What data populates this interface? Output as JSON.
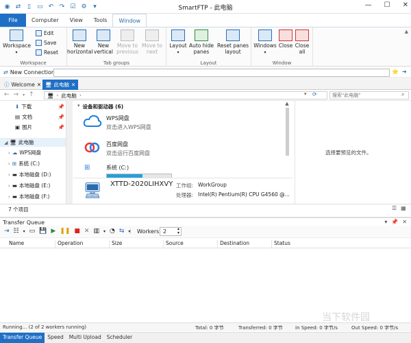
{
  "title": "SmartFTP - 此电脑",
  "window_controls": [
    "—",
    "☐",
    "✕"
  ],
  "ribbon_tabs": [
    "File",
    "Computer",
    "View",
    "Tools",
    "Window"
  ],
  "ribbon": {
    "workspace": {
      "label": "Workspace",
      "big": "Workspace",
      "edit": "Edit",
      "save": "Save",
      "reset": "Reset"
    },
    "tab_groups": {
      "label": "Tab groups",
      "new_horizontal": "New\nhorizontal",
      "new_vertical": "New\nvertical",
      "move_previous": "Move to\nprevious",
      "move_next": "Move to\nnext"
    },
    "layout": {
      "label": "Layout",
      "layout": "Layout",
      "auto_hide": "Auto hide\npanes",
      "reset_panes": "Reset panes\nlayout"
    },
    "window": {
      "label": "Window",
      "windows": "Windows",
      "close": "Close",
      "close_all": "Close\nall"
    }
  },
  "new_connection": {
    "label": "New Connection",
    "value": ""
  },
  "doc_tabs": [
    "Welcome",
    "此电脑"
  ],
  "breadcrumb": {
    "root": "此电脑",
    "search_placeholder": "搜索\"此电脑\""
  },
  "tree": [
    {
      "label": "下载",
      "pinned": true
    },
    {
      "label": "文档",
      "pinned": true
    },
    {
      "label": "图片",
      "pinned": true
    },
    {
      "label": "此电脑",
      "selected": true
    },
    {
      "label": "WPS网盘"
    },
    {
      "label": "系统 (C:)"
    },
    {
      "label": "本地磁盘 (D:)"
    },
    {
      "label": "本地磁盘 (E:)"
    },
    {
      "label": "本地磁盘 (F:)"
    }
  ],
  "devices": {
    "header": "设备和驱动器 (6)",
    "items": [
      {
        "name": "WPS网盘",
        "desc": "双击进入WPS网盘"
      },
      {
        "name": "百度网盘",
        "desc": "双击运行百度网盘"
      },
      {
        "name": "系统 (C:)",
        "desc": "",
        "usage": 0.55
      }
    ]
  },
  "computer_info": {
    "name": "XTTD-2020LIHXVY",
    "workgroup_label": "工作组:",
    "workgroup": "WorkGroup",
    "cpu_label": "处理器:",
    "cpu": "Intel(R) Pentium(R) CPU G4560 @..."
  },
  "preview_text": "选择要预览的文件。",
  "item_count": "7 个项目",
  "transfer_queue": {
    "title": "Transfer Queue",
    "workers_label": "Workers",
    "workers_value": "2",
    "columns": [
      "Name",
      "Operation",
      "Size",
      "Source",
      "Destination",
      "Status"
    ]
  },
  "status": {
    "running": "Running... (2 of 2 workers running)",
    "total": "Total: 0 字节",
    "transferred": "Transferred: 0 字节",
    "in_speed": "In Speed: 0 字节/s",
    "out_speed": "Out Speed: 0 字节/s"
  },
  "bottom_tabs": [
    "Transfer Queue",
    "Speed",
    "Multi Upload",
    "Scheduler"
  ],
  "watermark": "当下软件园"
}
